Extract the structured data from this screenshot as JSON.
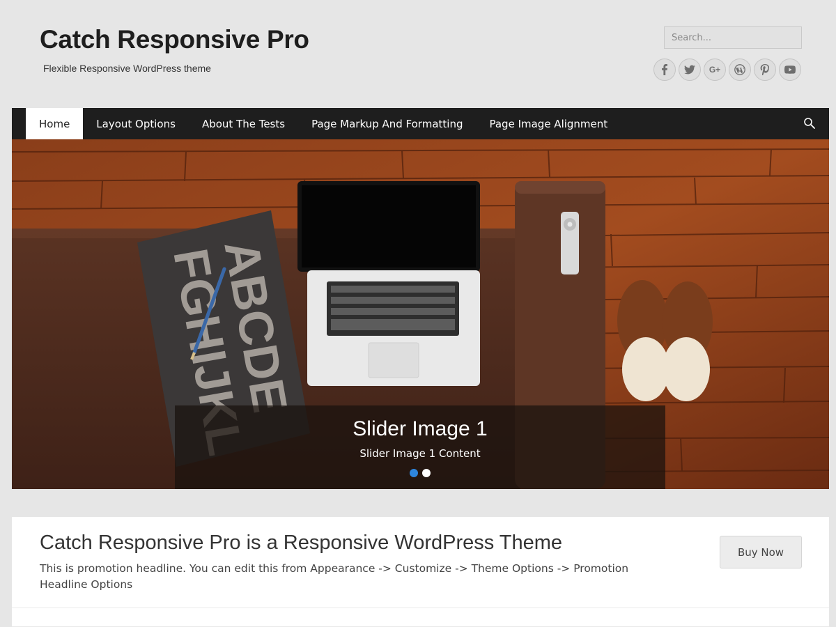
{
  "header": {
    "site_title": "Catch Responsive Pro",
    "tagline": "Flexible Responsive WordPress theme",
    "search_placeholder": "Search...",
    "social_icons": [
      "facebook-icon",
      "twitter-icon",
      "google-plus-icon",
      "wordpress-icon",
      "pinterest-icon",
      "youtube-icon"
    ]
  },
  "nav": {
    "items": [
      {
        "label": "Home",
        "active": true
      },
      {
        "label": "Layout Options",
        "active": false
      },
      {
        "label": "About The Tests",
        "active": false
      },
      {
        "label": "Page Markup And Formatting",
        "active": false
      },
      {
        "label": "Page Image Alignment",
        "active": false
      }
    ],
    "search_icon": "search-icon"
  },
  "slider": {
    "title": "Slider Image 1",
    "content": "Slider Image 1 Content",
    "slide_count": 2,
    "active_slide": 1
  },
  "promotion": {
    "headline": "Catch Responsive Pro is a Responsive WordPress Theme",
    "text": "This is promotion headline. You can edit this from Appearance -> Customize -> Theme Options -> Promotion Headline Options",
    "button_label": "Buy Now"
  },
  "colors": {
    "nav_background": "#1e1e1e",
    "page_background": "#e6e6e6",
    "pager_active": "#2e86de"
  }
}
